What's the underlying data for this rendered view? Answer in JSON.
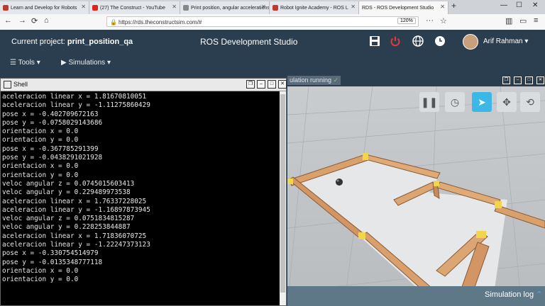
{
  "browser": {
    "tabs": [
      {
        "title": "Learn and Develop for Robots",
        "favicon_color": "#c0392b"
      },
      {
        "title": "(27) The Construct - YouTube",
        "favicon_color": "#e62117"
      },
      {
        "title": "Print position, angular accelerations",
        "favicon_color": "#777777"
      },
      {
        "title": "Robot Ignite Academy - ROS L",
        "favicon_color": "#c0392b"
      },
      {
        "title": "RDS - ROS Development Studio",
        "favicon_color": "#2b3e4f"
      }
    ],
    "url": "https://rds.theconstructsim.com/#",
    "zoom": "120%"
  },
  "header": {
    "project_label": "Current project:",
    "project_name": "print_position_qa",
    "app_title": "ROS Development Studio",
    "user_name": "Arif Rahman"
  },
  "toolbar": {
    "tools_label": "Tools",
    "simulations_label": "Simulations"
  },
  "shell": {
    "title": "Shell",
    "lines": [
      "aceleracion linear x = 1.81670810051",
      "aceleracion linear y = -1.11275860429",
      "pose x = -0.402709672163",
      "pose y = -0.0758029143686",
      "orientacion x = 0.0",
      "orientacion y = 0.0",
      "pose x = -0.367785291399",
      "pose y = -0.0438291021928",
      "orientacion x = 0.0",
      "orientacion y = 0.0",
      "veloc angular z = 0.0745015603413",
      "veloc angular y = 0.229489973538",
      "aceleracion linear x = 1.76337228025",
      "aceleracion linear y = -1.16897873945",
      "veloc angular z = 0.0751834815287",
      "veloc angular y = 0.228253844887",
      "aceleracion linear x = 1.71836070725",
      "aceleracion linear y = -1.22247373123",
      "pose x = -0.330754514979",
      "pose y = -0.0135348777118",
      "orientacion x = 0.0",
      "orientacion y = 0.0"
    ]
  },
  "gazebo": {
    "status": "ulation running",
    "sim_log_label": "Simulation log"
  }
}
